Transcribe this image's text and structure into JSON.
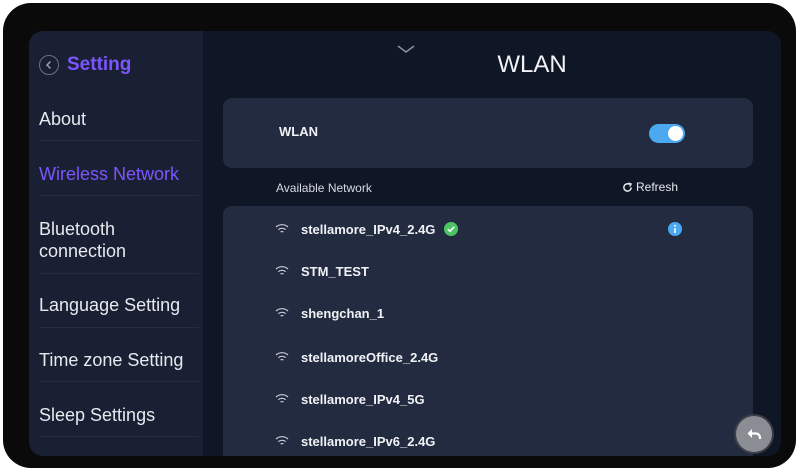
{
  "sidebar": {
    "title": "Setting",
    "items": [
      {
        "label": "About",
        "active": false
      },
      {
        "label": "Wireless Network",
        "active": true
      },
      {
        "label": "Bluetooth connection",
        "active": false
      },
      {
        "label": "Language Setting",
        "active": false
      },
      {
        "label": "Time zone Setting",
        "active": false
      },
      {
        "label": "Sleep Settings",
        "active": false
      }
    ]
  },
  "main": {
    "title": "WLAN",
    "wlan_toggle": {
      "label": "WLAN",
      "on": true
    },
    "available_label": "Available Network",
    "refresh_label": "Refresh",
    "networks": [
      {
        "name": "stellamore_IPv4_2.4G",
        "connected": true
      },
      {
        "name": "STM_TEST",
        "connected": false
      },
      {
        "name": "shengchan_1",
        "connected": false
      },
      {
        "name": "stellamoreOffice_2.4G",
        "connected": false
      },
      {
        "name": "stellamore_IPv4_5G",
        "connected": false
      },
      {
        "name": "stellamore_IPv6_2.4G",
        "connected": false
      }
    ]
  },
  "colors": {
    "accent": "#7d55ff",
    "toggle": "#4aa9f0",
    "connected": "#4cc463",
    "info": "#4aa9f0"
  },
  "icons": [
    "back-circle-icon",
    "chevron-down-icon",
    "refresh-icon",
    "wifi-icon",
    "check-circle-icon",
    "info-icon",
    "return-icon"
  ]
}
